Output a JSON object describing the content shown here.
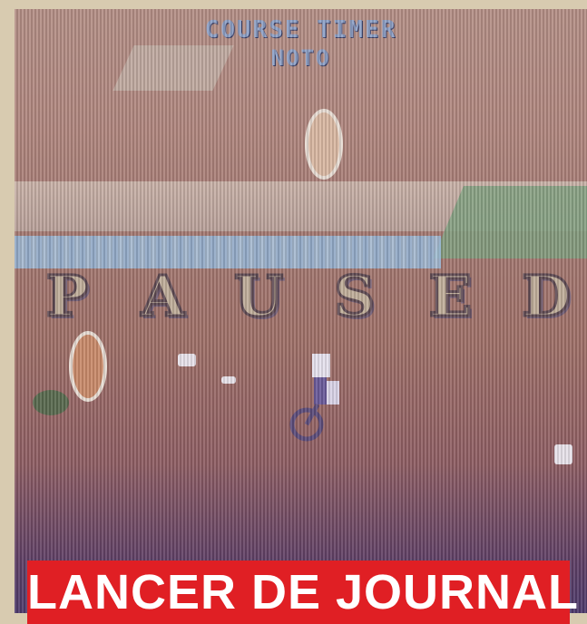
{
  "hud": {
    "title": "COURSE TIMER",
    "score": "NOTO"
  },
  "pause_overlay": {
    "letters": [
      "P",
      "A",
      "U",
      "S",
      "E",
      "D"
    ]
  },
  "caption": {
    "text": "LANCER DE JOURNAL"
  },
  "colors": {
    "banner": "#e01f24",
    "paused_fill": "#bfae9a",
    "hud_text": "#8da0c6"
  }
}
